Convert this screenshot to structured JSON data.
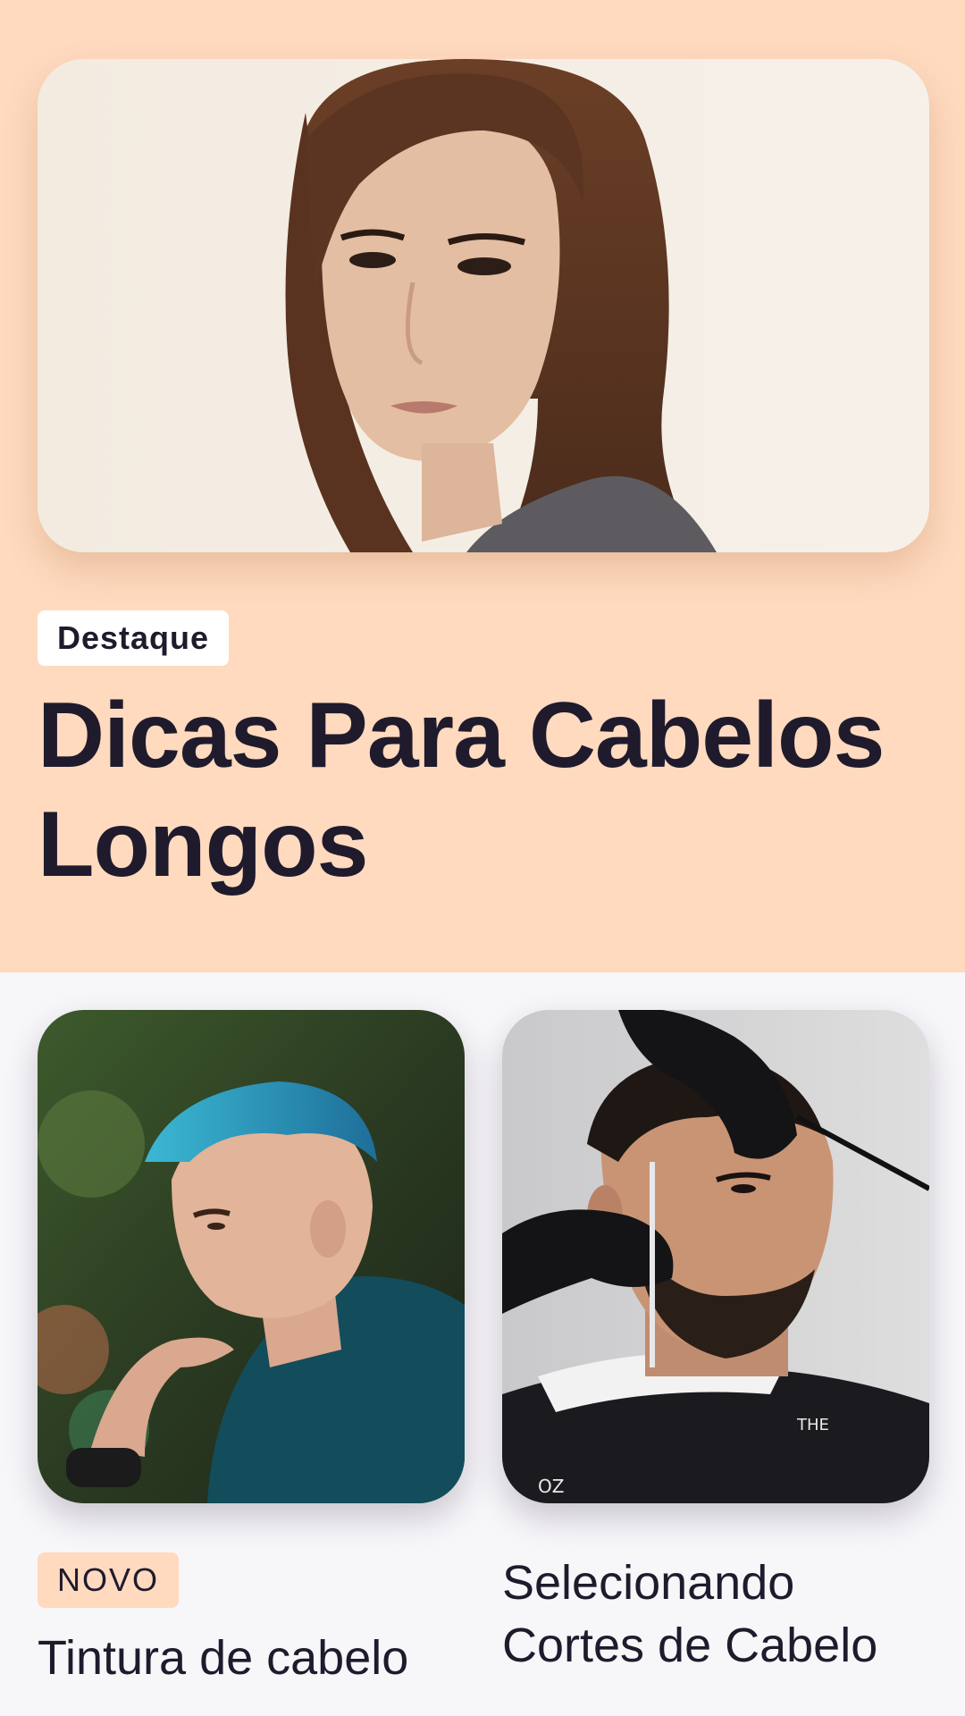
{
  "featured": {
    "badge": "Destaque",
    "title": "Dicas Para Cabelos Longos",
    "image": "long-hair-portrait-photo"
  },
  "cards": [
    {
      "badge": "NOVO",
      "title": "Tintura de cabelo",
      "image": "blue-dyed-hair-photo"
    },
    {
      "title": "Selecionando Cortes de Cabelo",
      "image": "barber-beard-trim-photo"
    }
  ],
  "colors": {
    "featured_background": "#ffdabf",
    "page_background": "#f7f6f9",
    "text": "#1f1b2d",
    "featured_badge_background": "#ffffff",
    "new_badge_background": "#ffdabf"
  }
}
